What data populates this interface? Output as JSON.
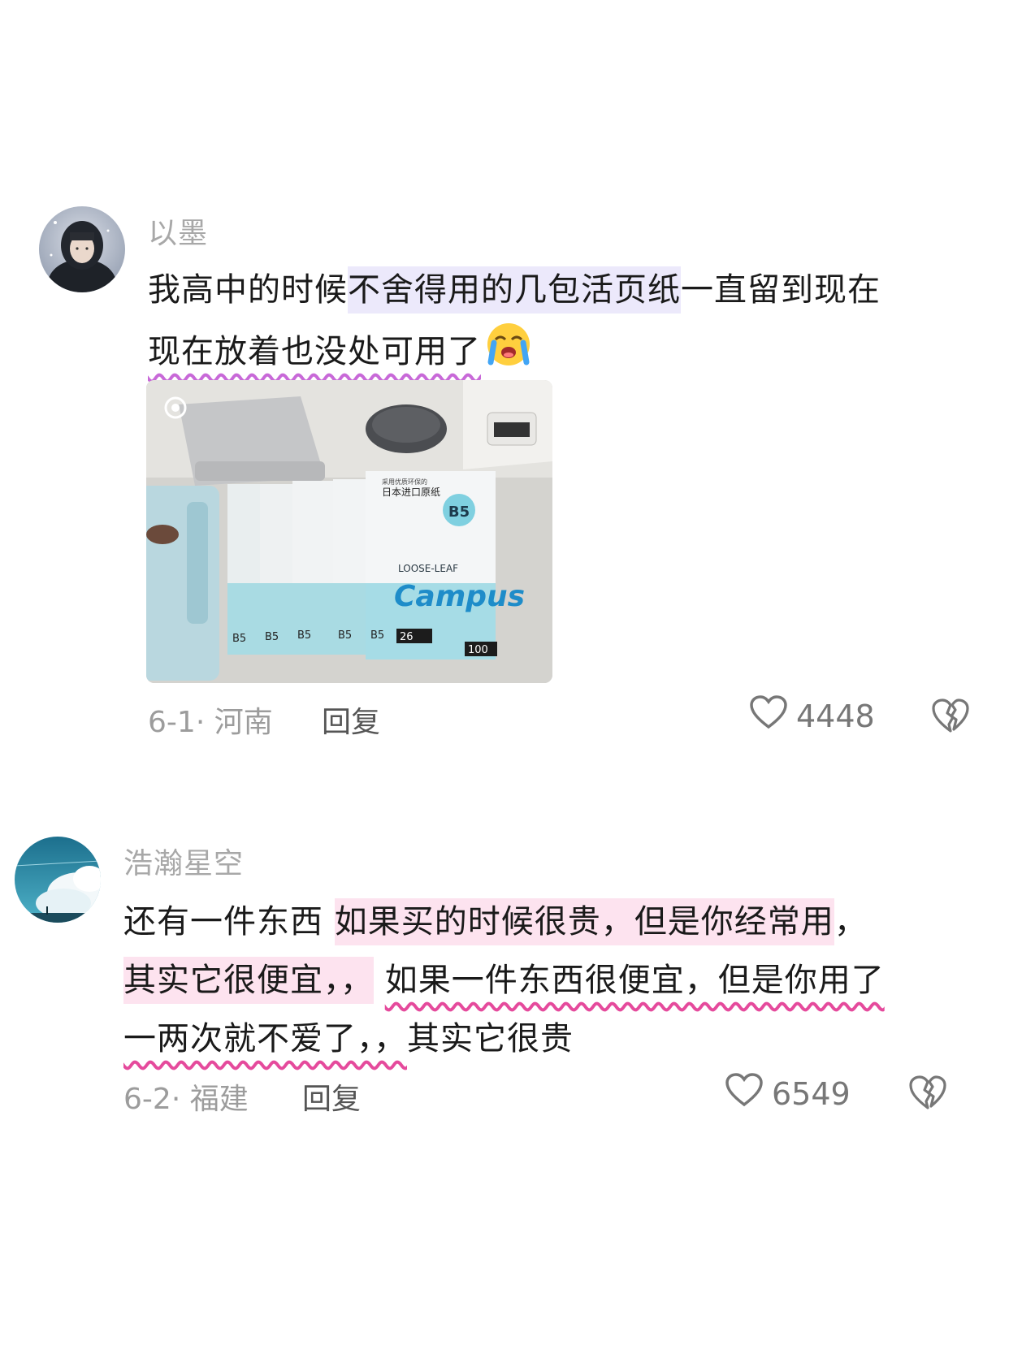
{
  "comments": [
    {
      "username": "以墨",
      "line1": {
        "a": "我高中的时候",
        "b": "不舍得用的几包活页纸",
        "c": "一直留到现在"
      },
      "line2": "现在放着也没处可用了",
      "emoji": "crying-face-icon",
      "photo": {
        "brand": "Campus",
        "label": "LOOSE-LEAF",
        "size": "B5",
        "size_small": "B5",
        "holes": "26",
        "sheets": "100",
        "header": "日本进口原纸",
        "subheader": "采用优质环保的"
      },
      "date": "6-1",
      "location": "河南",
      "reply_label": "回复",
      "likes": "4448"
    },
    {
      "username": "浩瀚星空",
      "line1": {
        "a": "还有一件东西 ",
        "b": "如果买的时候很贵，但是你经常用",
        "c": "，"
      },
      "line2": {
        "a": "其实它很便宜，，",
        "b": " ",
        "c": "如果一件东西很便宜，但是你用了"
      },
      "line3": {
        "a": "一两次就不爱了，，",
        "b": "其实它很贵"
      },
      "date": "6-2",
      "location": "福建",
      "reply_label": "回复",
      "likes": "6549"
    }
  ],
  "colors": {
    "highlight_purple": "#ece9fb",
    "highlight_pink": "#fde3ef",
    "wavy_purple": "#c869d8",
    "wavy_pink": "#e54a9c"
  }
}
